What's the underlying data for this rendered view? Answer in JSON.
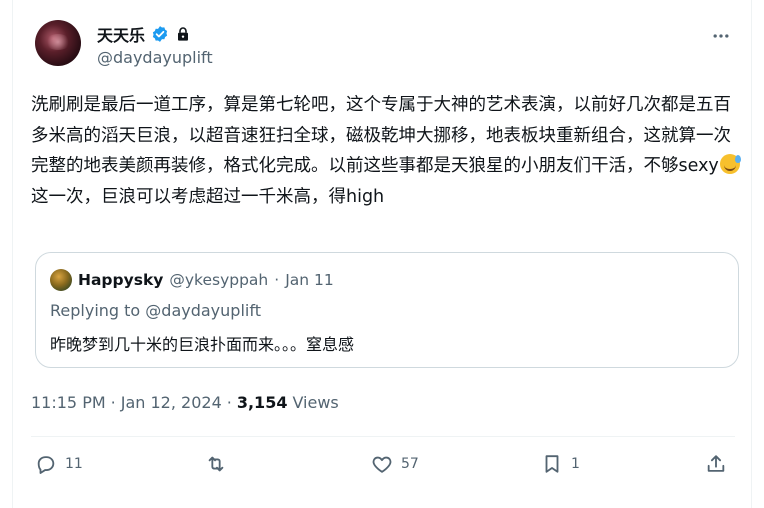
{
  "author": {
    "display_name": "天天乐",
    "handle": "@daydayuplift"
  },
  "tweet": {
    "text_before_emoji": "洗刷刷是最后一道工序，算是第七轮吧，这个专属于大神的艺术表演，以前好几次都是五百多米高的滔天巨浪，以超音速狂扫全球，磁极乾坤大挪移，地表板块重新组合，这就算一次完整的地表美颜再装修，格式化完成。以前这些事都是天狼星的小朋友们干活，不够sexy",
    "emoji": "sweat-smile-emoji",
    "text_after_emoji": "这一次，巨浪可以考虑超过一千米高，得high"
  },
  "quoted": {
    "display_name": "Happysky",
    "handle": "@ykesyppah",
    "separator": "·",
    "date": "Jan 11",
    "replying_to": "Replying to @daydayuplift",
    "text": "昨晚梦到几十米的巨浪扑面而来。。。窒息感"
  },
  "meta": {
    "time": "11:15 PM",
    "sep1": "·",
    "date": "Jan 12, 2024",
    "sep2": "·",
    "views_count": "3,154",
    "views_label": "Views"
  },
  "actions": {
    "reply_count": "11",
    "retweet_count": "",
    "like_count": "57",
    "bookmark_count": "1"
  },
  "colors": {
    "verified": "#1d9bf0",
    "secondary_text": "#536471",
    "primary_text": "#0f1419",
    "border": "#cfd9de"
  }
}
